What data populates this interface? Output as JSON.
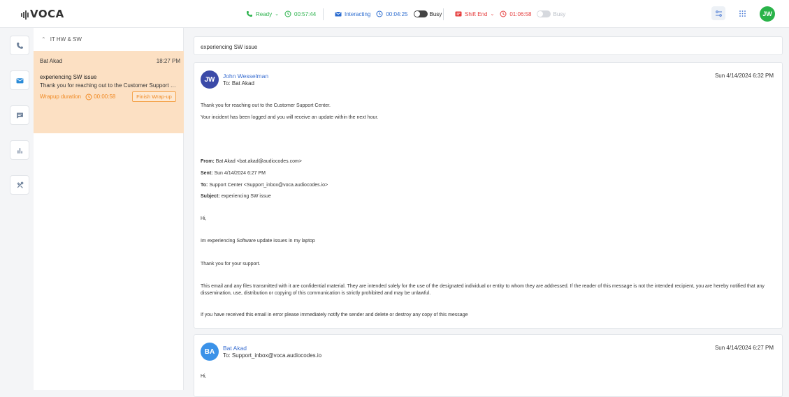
{
  "app": {
    "logo": "VOCA"
  },
  "status": {
    "ready_label": "Ready",
    "ready_timer": "00:57:44",
    "interacting_label": "Interacting",
    "interacting_timer": "00:04:25",
    "busy_label_1": "Busy",
    "shift_label": "Shift End",
    "shift_timer": "01:06:58",
    "busy_label_2": "Busy"
  },
  "user": {
    "initials": "JW"
  },
  "queue": {
    "group_label": "IT HW & SW"
  },
  "conversation": {
    "name": "Bat Akad",
    "time": "18:27 PM",
    "subject": "experiencing SW issue",
    "snippet": "Thank you for reaching out to the Customer Support Center. Your incident has been logged",
    "wrapup_label": "Wrapup duration",
    "wrapup_timer": "00:00:58",
    "finish_label": "Finish Wrap-up"
  },
  "subject_bar": "experiencing SW issue",
  "email1": {
    "initials": "JW",
    "sender": "John Wesselman",
    "to": "To: Bat Akad",
    "date": "Sun 4/14/2024 6:32 PM",
    "line1": "Thank you for reaching out to the Customer Support Center.",
    "line2": "Your incident has been logged and you will receive an update within the next hour.",
    "from_label": "From:",
    "from_value": "Bat Akad <bat.akad@audiocodes.com>",
    "sent_label": "Sent:",
    "sent_value": "Sun 4/14/2024 6:27 PM",
    "to_label": "To:",
    "to_value": "Support Center <Support_inbox@voca.audiocodes.io>",
    "subject_label": "Subject:",
    "subject_value": "experiencing SW issue",
    "hi": "Hi,",
    "issue": "Im experiencing Software update issues in my laptop",
    "thanks": "Thank you for your support.",
    "disclaimer_1": "This email and any files transmitted with it are confidential material. They are intended solely for the use of the designated individual or entity to whom they are addressed. If the reader of this message is not the intended recipient, you are hereby notified that any",
    "disclaimer_2": "dissemination, use, distribution or copying of this communication is strictly prohibited and may be unlawful.",
    "error_note": "If you have received this email in error please immediately notify the sender and delete or destroy any copy of this message"
  },
  "email2": {
    "initials": "BA",
    "sender": "Bat Akad",
    "to": "To: Support_inbox@voca.audiocodes.io",
    "date": "Sun 4/14/2024 6:27 PM",
    "hi": "Hi,"
  },
  "colors": {
    "accent_green": "#2bb24c",
    "accent_blue": "#2a6bcf",
    "accent_red": "#e53b3b",
    "wrap_orange": "#f08a24"
  },
  "icons": [
    "phone-icon",
    "clock-icon",
    "mail-icon",
    "chat-icon",
    "stats-icon",
    "tools-icon",
    "settings-icon",
    "grid-icon",
    "chevron-up-icon",
    "chevron-down-icon",
    "flag-icon"
  ]
}
